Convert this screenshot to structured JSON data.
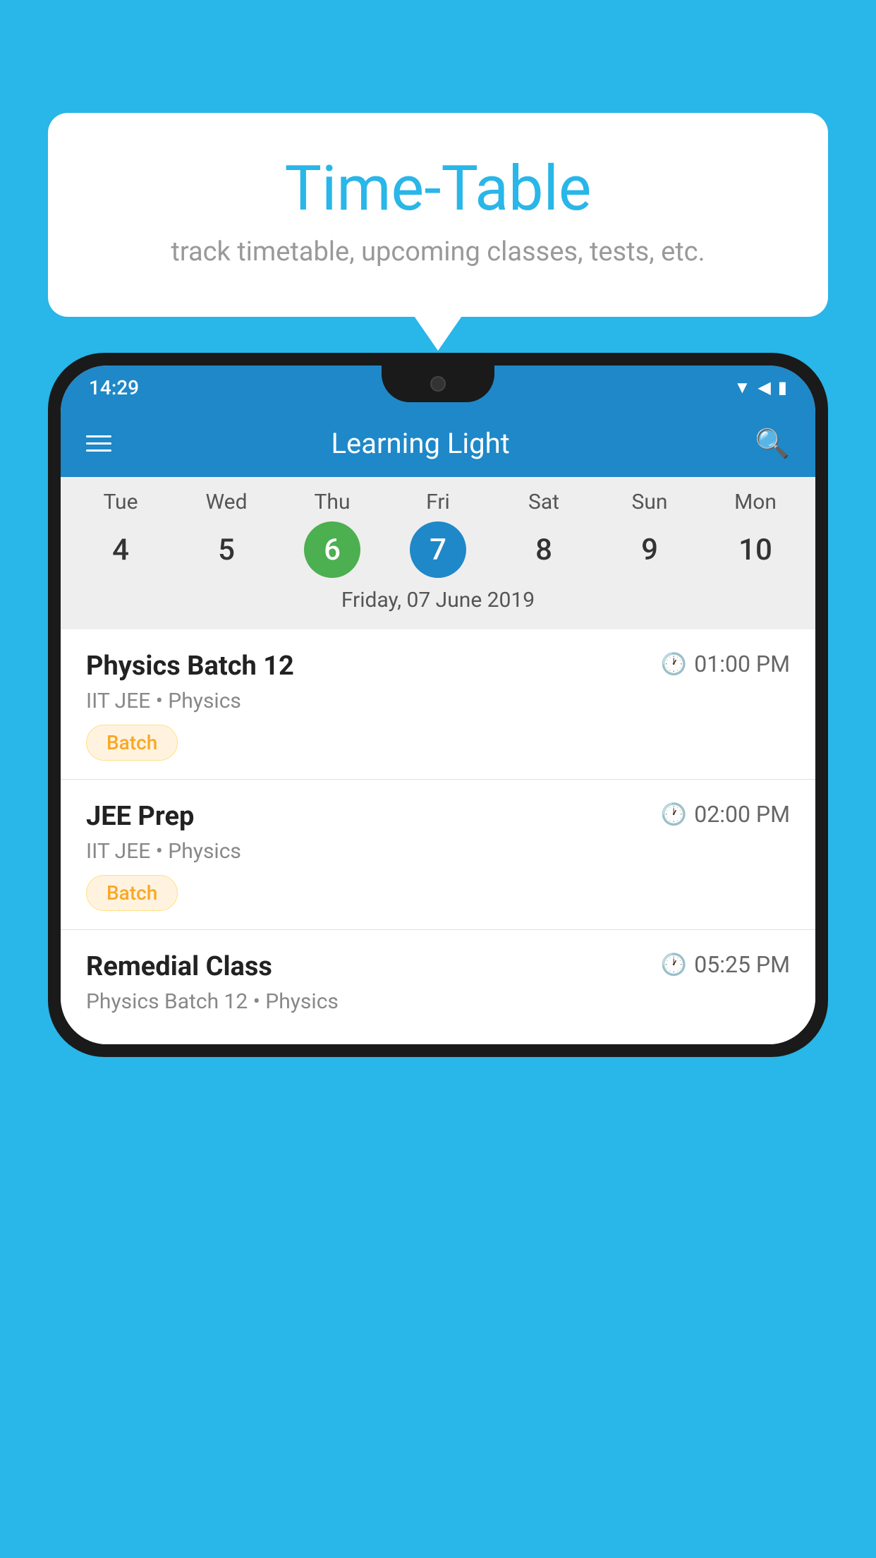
{
  "background_color": "#29B6E8",
  "bubble": {
    "title": "Time-Table",
    "subtitle": "track timetable, upcoming classes, tests, etc."
  },
  "phone": {
    "status_bar": {
      "time": "14:29"
    },
    "app_bar": {
      "title": "Learning Light"
    },
    "calendar": {
      "days": [
        {
          "name": "Tue",
          "num": "4",
          "state": "normal"
        },
        {
          "name": "Wed",
          "num": "5",
          "state": "normal"
        },
        {
          "name": "Thu",
          "num": "6",
          "state": "today"
        },
        {
          "name": "Fri",
          "num": "7",
          "state": "selected"
        },
        {
          "name": "Sat",
          "num": "8",
          "state": "normal"
        },
        {
          "name": "Sun",
          "num": "9",
          "state": "normal"
        },
        {
          "name": "Mon",
          "num": "10",
          "state": "normal"
        }
      ],
      "selected_date_label": "Friday, 07 June 2019"
    },
    "schedule_items": [
      {
        "title": "Physics Batch 12",
        "time": "01:00 PM",
        "subtitle": "IIT JEE • Physics",
        "badge": "Batch"
      },
      {
        "title": "JEE Prep",
        "time": "02:00 PM",
        "subtitle": "IIT JEE • Physics",
        "badge": "Batch"
      },
      {
        "title": "Remedial Class",
        "time": "05:25 PM",
        "subtitle": "Physics Batch 12 • Physics",
        "badge": null
      }
    ]
  }
}
